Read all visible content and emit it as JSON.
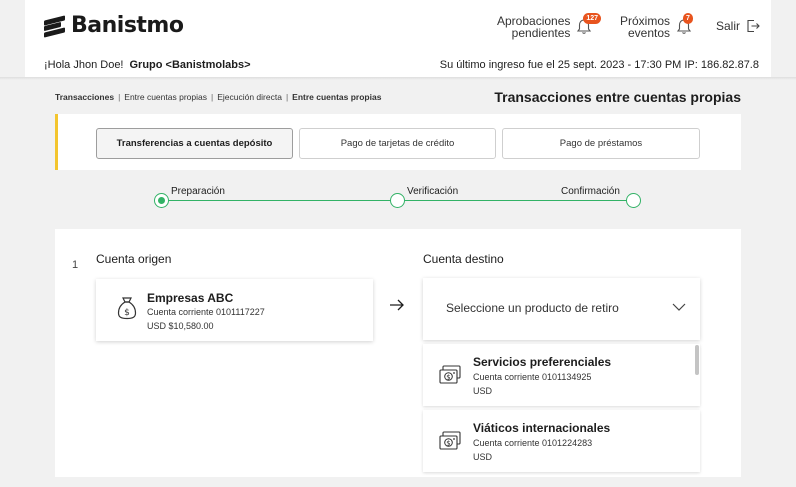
{
  "brand": {
    "name": "Banistmo"
  },
  "header": {
    "approvals": {
      "line1": "Aprobaciones",
      "line2": "pendientes",
      "count": "127"
    },
    "events": {
      "line1": "Próximos",
      "line2": "eventos",
      "count": "7"
    },
    "logout": "Salir",
    "greeting": "¡Hola Jhon Doe!",
    "group": "Grupo <Banistmolabs>",
    "last_login": "Su último ingreso fue el 25 sept. 2023 - 17:30 PM IP: 186.82.87.8"
  },
  "breadcrumb": {
    "items": [
      "Transacciones",
      "Entre cuentas propias",
      "Ejecución directa",
      "Entre cuentas propias"
    ],
    "separator": "|"
  },
  "page_title": "Transacciones entre cuentas propias",
  "tabs": [
    {
      "label": "Transferencias a cuentas depósito",
      "active": true
    },
    {
      "label": "Pago de tarjetas de crédito",
      "active": false
    },
    {
      "label": "Pago de préstamos",
      "active": false
    }
  ],
  "stepper": {
    "steps": [
      "Preparación",
      "Verificación",
      "Confirmación"
    ],
    "current": 0
  },
  "form": {
    "row_number": "1",
    "origin_title": "Cuenta origen",
    "destination_title": "Cuenta destino",
    "origin_account": {
      "name": "Empresas ABC",
      "type_number": "Cuenta corriente 0101117227",
      "balance": "USD $10,580.00",
      "icon": "money-bag-icon"
    },
    "destination_placeholder": "Seleccione un producto de retiro",
    "destination_options": [
      {
        "name": "Servicios preferenciales",
        "type_number": "Cuenta corriente 0101134925",
        "currency": "USD",
        "icon": "cash-card-icon"
      },
      {
        "name": "Viáticos internacionales",
        "type_number": "Cuenta corriente 0101224283",
        "currency": "USD",
        "icon": "cash-card-icon"
      }
    ]
  },
  "colors": {
    "accent_green": "#32b266",
    "tab_accent": "#f3c52e",
    "badge": "#e8541e"
  }
}
